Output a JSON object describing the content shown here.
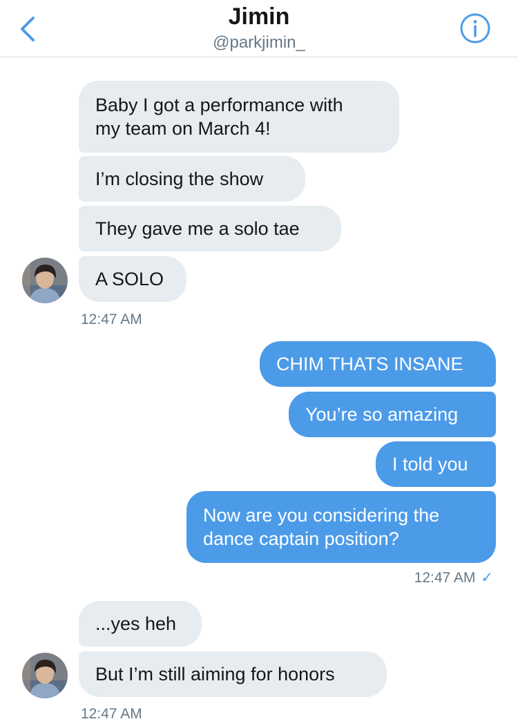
{
  "header": {
    "title": "Jimin",
    "handle": "@parkjimin_"
  },
  "colors": {
    "accent": "#4c9be8",
    "incoming_bubble": "#e6ecf0",
    "timestamp": "#657786"
  },
  "icons": {
    "back": "chevron-left-icon",
    "info": "info-icon"
  },
  "messages": {
    "group1": {
      "m1": "Baby I got a performance with\nmy team on March 4!",
      "m2": "I’m closing the show",
      "m3": "They gave me a solo tae",
      "m4": "A SOLO",
      "time": "12:47 AM"
    },
    "group2": {
      "m1": "CHIM THATS INSANE",
      "m2": "You’re so amazing",
      "m3": "I told you",
      "m4": "Now are you considering the\ndance captain position?",
      "time": "12:47 AM",
      "read_mark": "✓"
    },
    "group3": {
      "m1": "...yes heh",
      "m2": "But I’m still aiming for honors",
      "time": "12:47 AM"
    }
  }
}
